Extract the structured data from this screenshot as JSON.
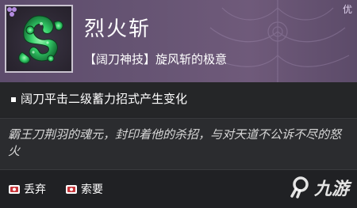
{
  "item": {
    "name": "烈火斩",
    "subtitle": "【阔刀神技】旋风斩的极意",
    "badge": "优",
    "icon": "jade-serpent-icon"
  },
  "effect": {
    "text": "阔刀平击二级蓄力招式产生变化"
  },
  "lore": {
    "text": "霸王刀荆羽的魂元，封印着他的杀招，与对天道不公诉不尽的怒火"
  },
  "actions": [
    {
      "label": "丢弃",
      "icon": "key-icon"
    },
    {
      "label": "索要",
      "icon": "key-icon"
    }
  ],
  "watermark": {
    "text": "九游",
    "icon": "jiuyou-logo-icon"
  },
  "colors": {
    "header_bg": "#665473",
    "icon_green": "#35d16a",
    "quality_purple": "#b38be0",
    "key_red": "#c7353a"
  }
}
